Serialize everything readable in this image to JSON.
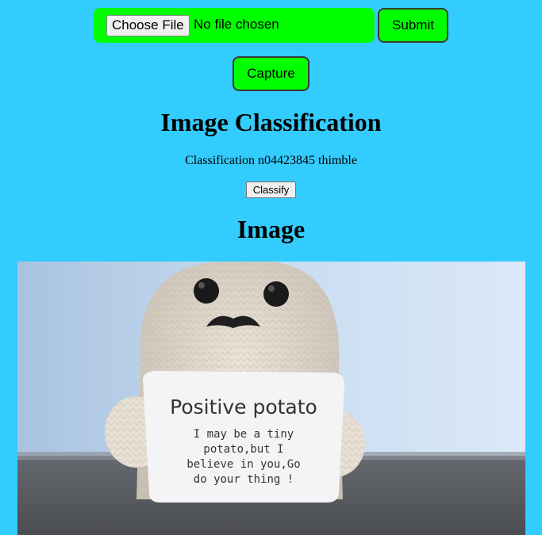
{
  "upload": {
    "choose_file_label": "Choose File",
    "file_status": "No file chosen",
    "submit_label": "Submit",
    "accent_color": "#00ff00"
  },
  "capture": {
    "label": "Capture"
  },
  "page": {
    "title": "Image Classification",
    "background_color": "#33ccff"
  },
  "result": {
    "text": "Classification n04423845 thimble"
  },
  "classify": {
    "label": "Classify"
  },
  "image_section": {
    "heading": "Image",
    "sign_title": "Positive potato",
    "sign_lines": [
      "I may be a tiny",
      "potato,but I",
      "believe in you,Go",
      "do your thing !"
    ]
  }
}
